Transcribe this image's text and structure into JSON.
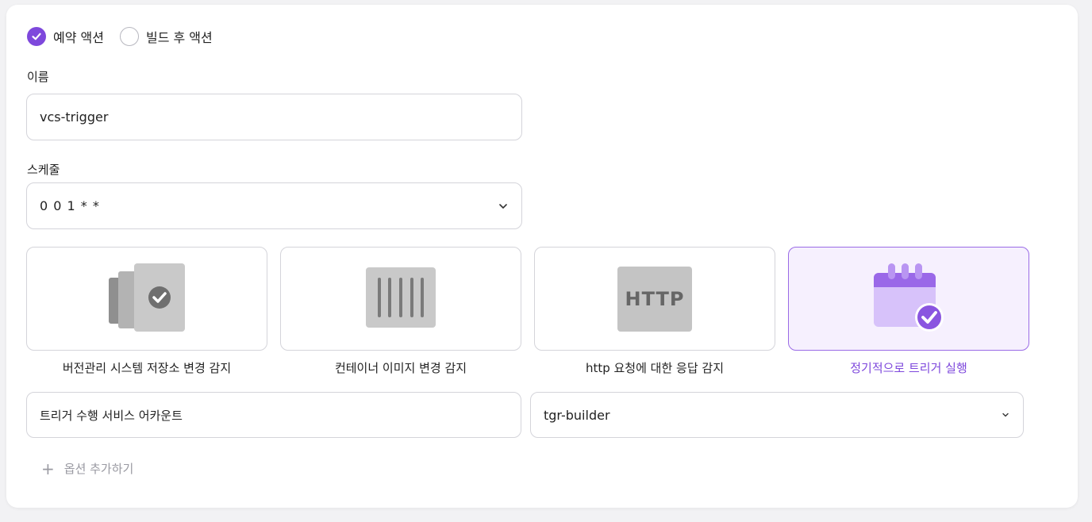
{
  "action_type": {
    "options": [
      {
        "label": "예약 액션",
        "checked": true
      },
      {
        "label": "빌드 후 액션",
        "checked": false
      }
    ]
  },
  "name_field": {
    "label": "이름",
    "value": "vcs-trigger"
  },
  "schedule_field": {
    "label": "스케줄",
    "value": "0 0 1 * *"
  },
  "trigger_types": [
    {
      "label": "버전관리 시스템 저장소 변경 감지",
      "icon": "vcs-repo-icon",
      "selected": false
    },
    {
      "label": "컨테이너 이미지 변경 감지",
      "icon": "container-image-icon",
      "selected": false
    },
    {
      "label": "http 요청에 대한 응답 감지",
      "icon": "http-icon",
      "badge_text": "HTTP",
      "selected": false
    },
    {
      "label": "정기적으로 트리거 실행",
      "icon": "calendar-check-icon",
      "selected": true
    }
  ],
  "service_account": {
    "label": "트리거 수행 서비스 어카운트",
    "value": "tgr-builder"
  },
  "add_option": {
    "label": "옵션 추가하기"
  },
  "colors": {
    "accent": "#7e48dc",
    "accent_light": "#f6f0fe",
    "border": "#d4d4da",
    "icon_gray": "#c4c4c4",
    "muted_text": "#9a9aa2"
  }
}
